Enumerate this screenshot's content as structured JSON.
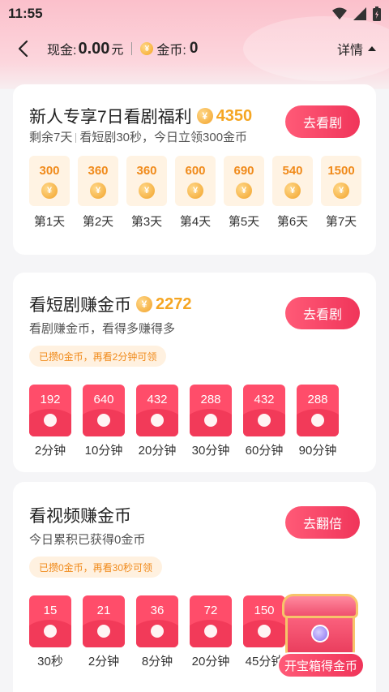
{
  "status_bar": {
    "time": "11:55"
  },
  "header": {
    "cash_label": "现金:",
    "cash_value": "0.00",
    "cash_unit": "元",
    "gold_label": "金币:",
    "gold_value": "0",
    "detail_label": "详情"
  },
  "newbie": {
    "title": "新人专享7日看剧福利",
    "amount": "4350",
    "remaining": "剩余7天",
    "desc": "看短剧30秒，今日立领300金币",
    "cta": "去看剧",
    "days": [
      {
        "value": "300",
        "label": "第1天"
      },
      {
        "value": "360",
        "label": "第2天"
      },
      {
        "value": "360",
        "label": "第3天"
      },
      {
        "value": "600",
        "label": "第4天"
      },
      {
        "value": "690",
        "label": "第5天"
      },
      {
        "value": "540",
        "label": "第6天"
      },
      {
        "value": "1500",
        "label": "第7天"
      }
    ]
  },
  "short_drama": {
    "title": "看短剧赚金币",
    "amount": "2272",
    "desc": "看剧赚金币，看得多赚得多",
    "cta": "去看剧",
    "tip": "已攒0金币，再看2分钟可领",
    "rewards": [
      {
        "value": "192",
        "label": "2分钟"
      },
      {
        "value": "640",
        "label": "10分钟"
      },
      {
        "value": "432",
        "label": "20分钟"
      },
      {
        "value": "288",
        "label": "30分钟"
      },
      {
        "value": "432",
        "label": "60分钟"
      },
      {
        "value": "288",
        "label": "90分钟"
      }
    ]
  },
  "video": {
    "title": "看视频赚金币",
    "desc": "今日累积已获得0金币",
    "cta": "去翻倍",
    "tip": "已攒0金币，再看30秒可领",
    "rewards": [
      {
        "value": "15",
        "label": "30秒"
      },
      {
        "value": "21",
        "label": "2分钟"
      },
      {
        "value": "36",
        "label": "8分钟"
      },
      {
        "value": "72",
        "label": "20分钟"
      },
      {
        "value": "150",
        "label": "45分钟"
      }
    ]
  },
  "treasure": {
    "label": "开宝箱得金币"
  },
  "colors": {
    "accent": "#f0355a",
    "gold": "#f5a623",
    "tip_text": "#f08a1a"
  },
  "icons": [
    "back-arrow-icon",
    "coin-icon",
    "triangle-up-icon",
    "wifi-icon",
    "signal-icon",
    "battery-icon",
    "treasure-chest-icon"
  ]
}
